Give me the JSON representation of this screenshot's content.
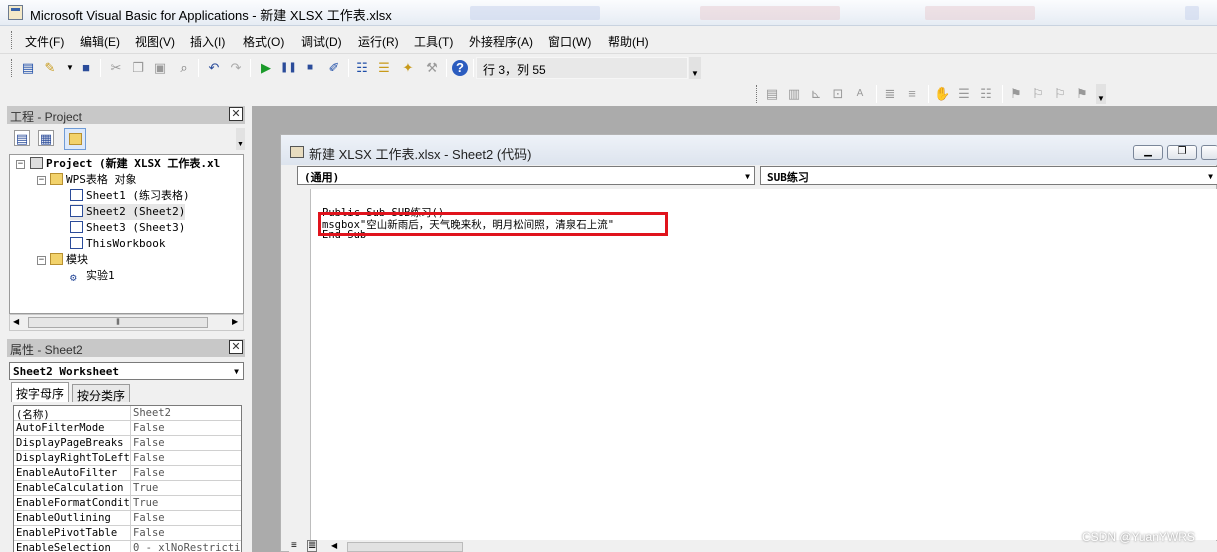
{
  "window_title": "Microsoft Visual Basic for Applications - 新建 XLSX 工作表.xlsx",
  "menu": [
    "文件(F)",
    "编辑(E)",
    "视图(V)",
    "插入(I)",
    "格式(O)",
    "调试(D)",
    "运行(R)",
    "工具(T)",
    "外接程序(A)",
    "窗口(W)",
    "帮助(H)"
  ],
  "toolbar": {
    "position": "行 3，列 55"
  },
  "project": {
    "title": "工程 - Project",
    "root": "Project (新建 XLSX 工作表.xl",
    "folder_objects": "WPS表格 对象",
    "sheets": [
      "Sheet1 (练习表格)",
      "Sheet2 (Sheet2)",
      "Sheet3 (Sheet3)",
      "ThisWorkbook"
    ],
    "folder_modules": "模块",
    "modules": [
      "实验1"
    ]
  },
  "properties": {
    "title": "属性 - Sheet2",
    "object": "Sheet2 Worksheet",
    "tab_alpha": "按字母序",
    "tab_cat": "按分类序",
    "rows": [
      {
        "name": "(名称)",
        "value": "Sheet2"
      },
      {
        "name": "AutoFilterMode",
        "value": "False"
      },
      {
        "name": "DisplayPageBreaks",
        "value": "False"
      },
      {
        "name": "DisplayRightToLeft",
        "value": "False"
      },
      {
        "name": "EnableAutoFilter",
        "value": "False"
      },
      {
        "name": "EnableCalculation",
        "value": "True"
      },
      {
        "name": "EnableFormatConditi",
        "value": "True"
      },
      {
        "name": "EnableOutlining",
        "value": "False"
      },
      {
        "name": "EnablePivotTable",
        "value": "False"
      },
      {
        "name": "EnableSelection",
        "value": "0 - xlNoRestrictio"
      }
    ]
  },
  "code_window": {
    "title": "新建 XLSX 工作表.xlsx - Sheet2 (代码)",
    "object_combo": "(通用)",
    "proc_combo": "SUB练习",
    "lines": [
      "Public Sub SUB练习()",
      "msgbox\"空山新雨后，天气晚来秋，明月松间照，清泉石上流\"",
      "End Sub"
    ]
  },
  "watermark": "CSDN @YuanYWRS",
  "colors": {
    "highlight_border": "#e0131c"
  }
}
